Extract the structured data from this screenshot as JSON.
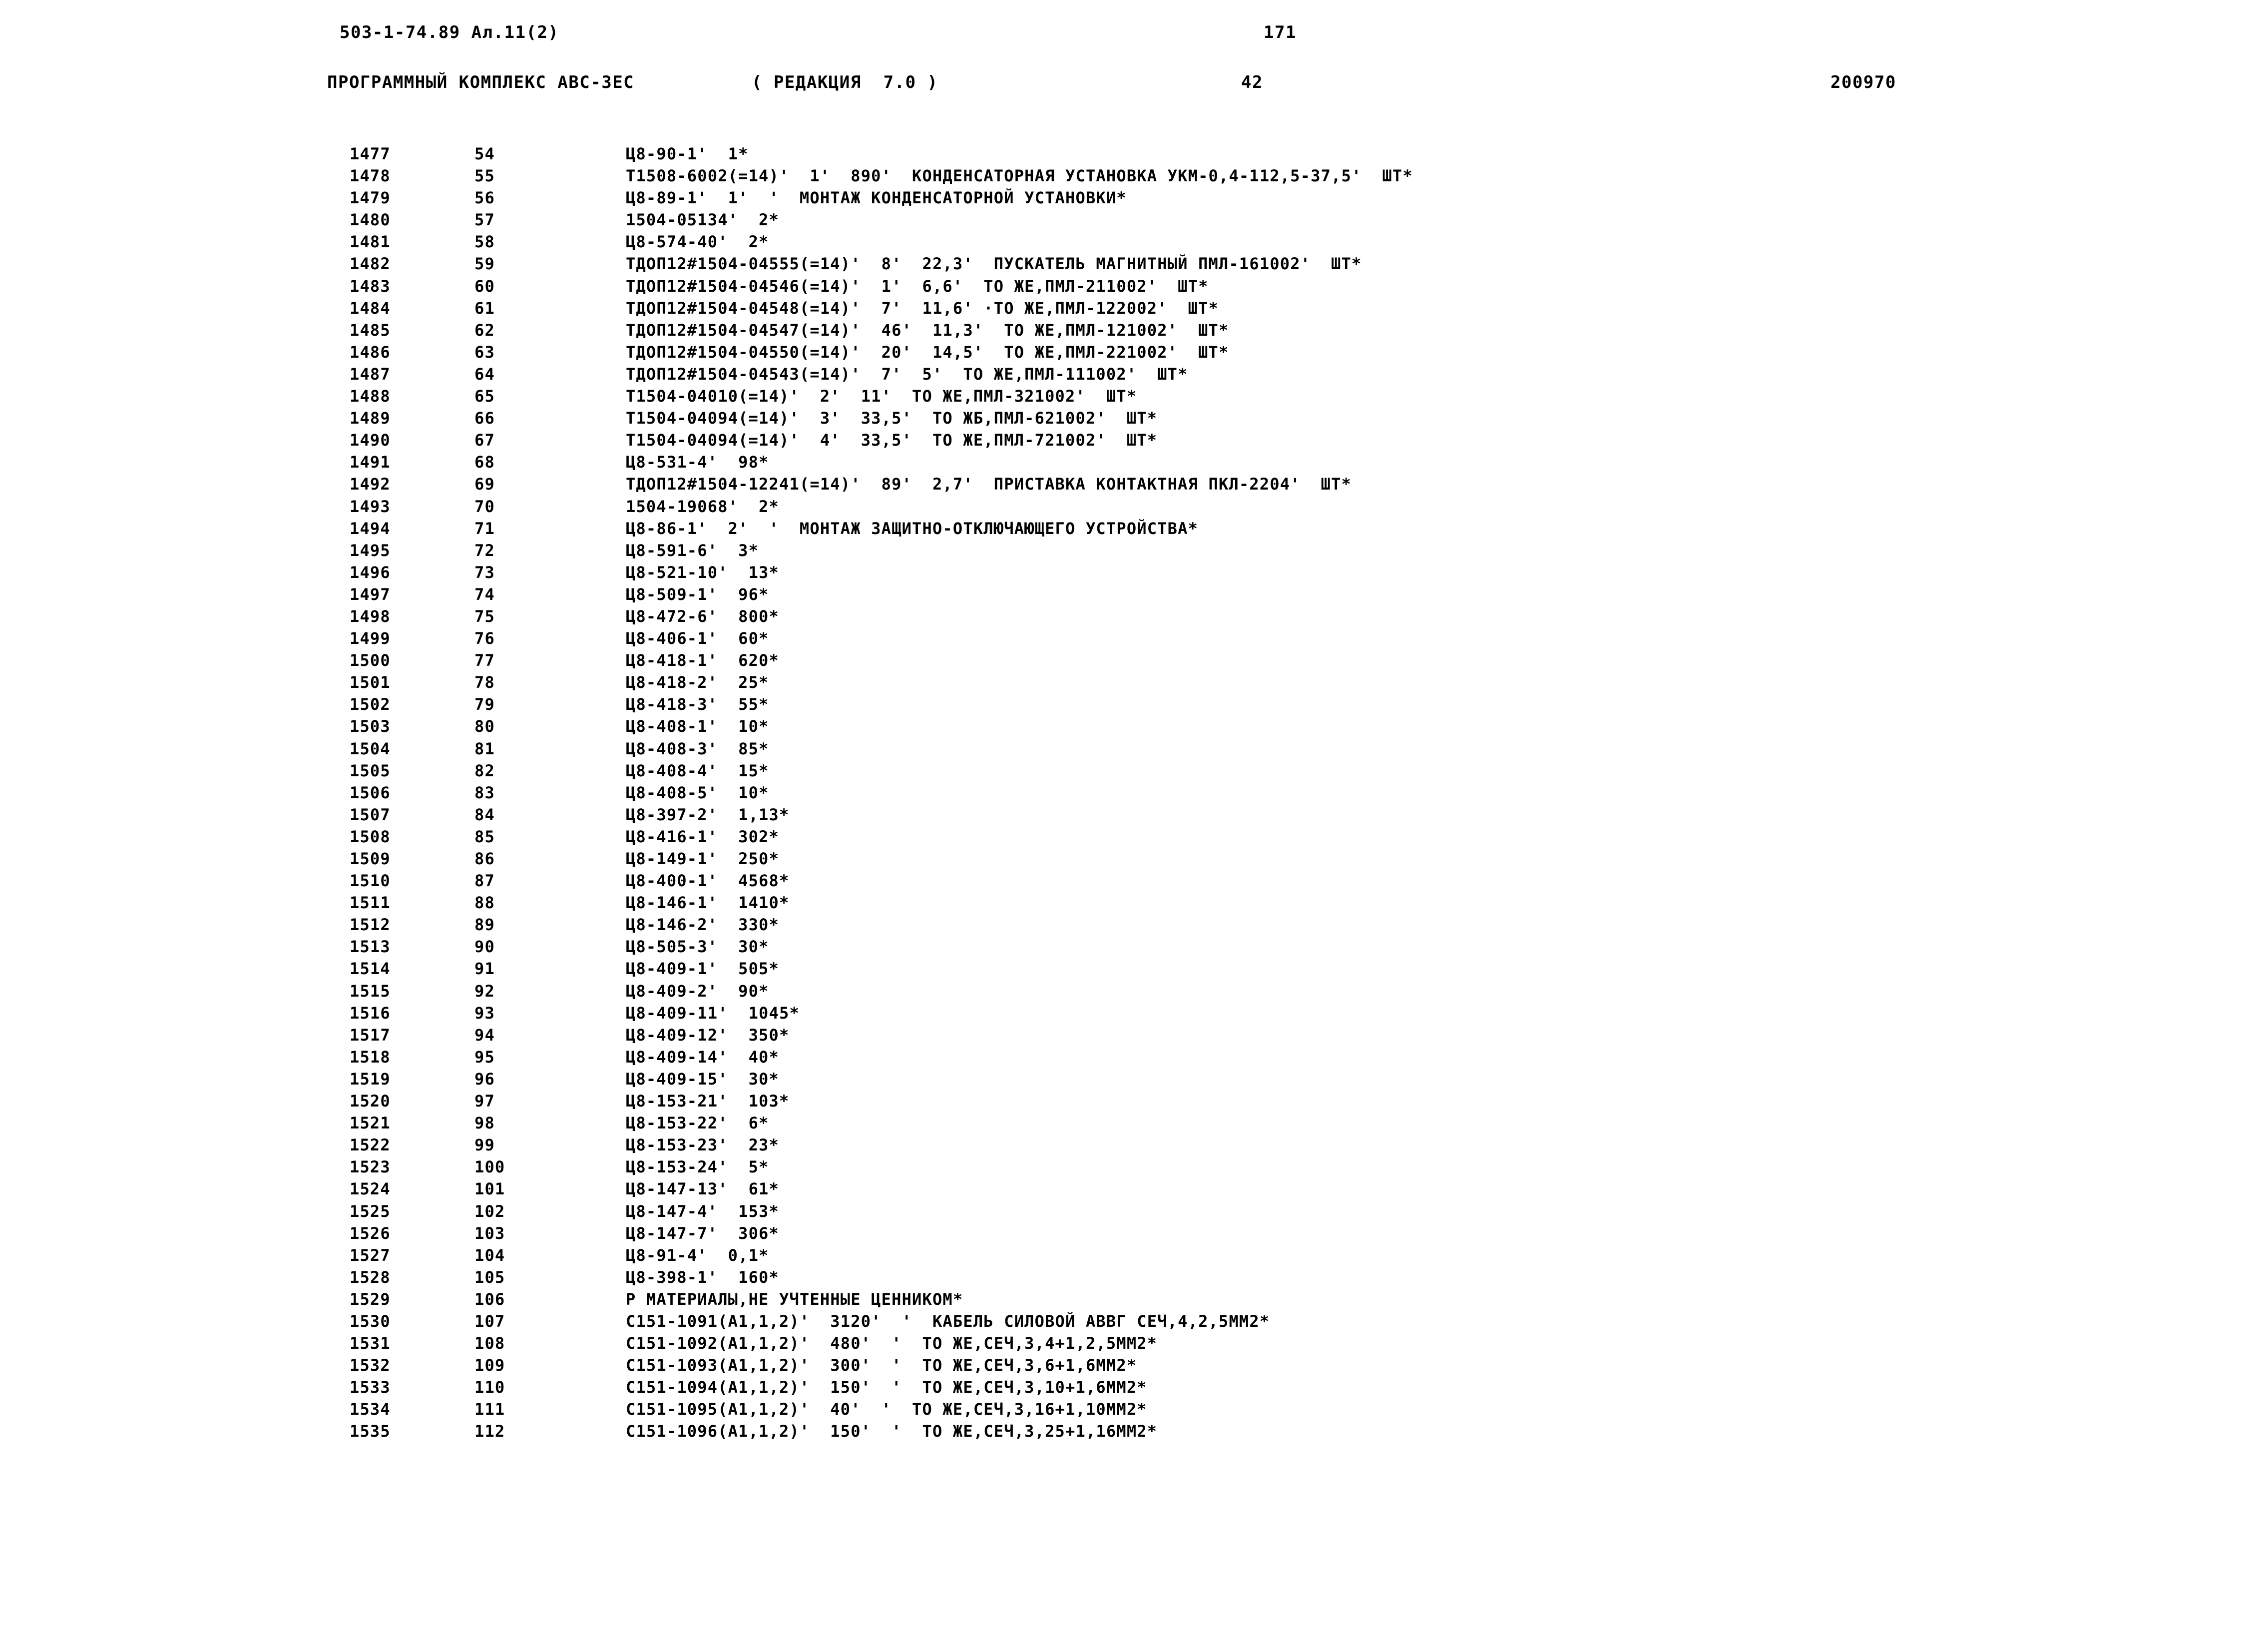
{
  "header": {
    "doc_code": "503-1-74.89 Ал.11(2)",
    "page_number": "171",
    "system_title": "ПРОГРАММНЫЙ КОМПЛЕКС АВС-3ЕС",
    "edition": "( РЕДАКЦИЯ  7.0 )",
    "sheet_number": "42",
    "date_code": "200970"
  },
  "listing": {
    "columns": [
      "line_number",
      "sequence_number",
      "record"
    ],
    "rows": [
      {
        "line_number": "1477",
        "sequence_number": "54",
        "record": "Ц8-90-1'  1*"
      },
      {
        "line_number": "1478",
        "sequence_number": "55",
        "record": "Т1508-6002(=14)'  1'  890'  КОНДЕНСАТОРНАЯ УСТАНОВКА УКМ-0,4-112,5-37,5'  ШТ*"
      },
      {
        "line_number": "1479",
        "sequence_number": "56",
        "record": "Ц8-89-1'  1'  '  МОНТАЖ КОНДЕНСАТОРНОЙ УСТАНОВКИ*"
      },
      {
        "line_number": "1480",
        "sequence_number": "57",
        "record": "1504-05134'  2*"
      },
      {
        "line_number": "1481",
        "sequence_number": "58",
        "record": "Ц8-574-40'  2*"
      },
      {
        "line_number": "1482",
        "sequence_number": "59",
        "record": "ТДОП12#1504-04555(=14)'  8'  22,3'  ПУСКАТЕЛЬ МАГНИТНЫЙ ПМЛ-161002'  ШТ*"
      },
      {
        "line_number": "1483",
        "sequence_number": "60",
        "record": "ТДОП12#1504-04546(=14)'  1'  6,6'  ТО ЖЕ,ПМЛ-211002'  ШТ*"
      },
      {
        "line_number": "1484",
        "sequence_number": "61",
        "record": "ТДОП12#1504-04548(=14)'  7'  11,6' ·ТО ЖЕ,ПМЛ-122002'  ШТ*"
      },
      {
        "line_number": "1485",
        "sequence_number": "62",
        "record": "ТДОП12#1504-04547(=14)'  46'  11,3'  ТО ЖЕ,ПМЛ-121002'  ШТ*"
      },
      {
        "line_number": "1486",
        "sequence_number": "63",
        "record": "ТДОП12#1504-04550(=14)'  20'  14,5'  ТО ЖЕ,ПМЛ-221002'  ШТ*"
      },
      {
        "line_number": "1487",
        "sequence_number": "64",
        "record": "ТДОП12#1504-04543(=14)'  7'  5'  ТО ЖЕ,ПМЛ-111002'  ШТ*"
      },
      {
        "line_number": "1488",
        "sequence_number": "65",
        "record": "Т1504-04010(=14)'  2'  11'  ТО ЖЕ,ПМЛ-321002'  ШТ*"
      },
      {
        "line_number": "1489",
        "sequence_number": "66",
        "record": "Т1504-04094(=14)'  3'  33,5'  ТО ЖБ,ПМЛ-621002'  ШТ*"
      },
      {
        "line_number": "1490",
        "sequence_number": "67",
        "record": "Т1504-04094(=14)'  4'  33,5'  ТО ЖЕ,ПМЛ-721002'  ШТ*"
      },
      {
        "line_number": "1491",
        "sequence_number": "68",
        "record": "Ц8-531-4'  98*"
      },
      {
        "line_number": "1492",
        "sequence_number": "69",
        "record": "ТДОП12#1504-12241(=14)'  89'  2,7'  ПРИСТАВКА КОНТАКТНАЯ ПКЛ-2204'  ШТ*"
      },
      {
        "line_number": "1493",
        "sequence_number": "70",
        "record": "1504-19068'  2*"
      },
      {
        "line_number": "1494",
        "sequence_number": "71",
        "record": "Ц8-86-1'  2'  '  МОНТАЖ ЗАЩИТНО-ОТКЛЮЧАЮЩЕГО УСТРОЙСТВА*"
      },
      {
        "line_number": "1495",
        "sequence_number": "72",
        "record": "Ц8-591-6'  3*"
      },
      {
        "line_number": "1496",
        "sequence_number": "73",
        "record": "Ц8-521-10'  13*"
      },
      {
        "line_number": "1497",
        "sequence_number": "74",
        "record": "Ц8-509-1'  96*"
      },
      {
        "line_number": "1498",
        "sequence_number": "75",
        "record": "Ц8-472-6'  800*"
      },
      {
        "line_number": "1499",
        "sequence_number": "76",
        "record": "Ц8-406-1'  60*"
      },
      {
        "line_number": "1500",
        "sequence_number": "77",
        "record": "Ц8-418-1'  620*"
      },
      {
        "line_number": "1501",
        "sequence_number": "78",
        "record": "Ц8-418-2'  25*"
      },
      {
        "line_number": "1502",
        "sequence_number": "79",
        "record": "Ц8-418-3'  55*"
      },
      {
        "line_number": "1503",
        "sequence_number": "80",
        "record": "Ц8-408-1'  10*"
      },
      {
        "line_number": "1504",
        "sequence_number": "81",
        "record": "Ц8-408-3'  85*"
      },
      {
        "line_number": "1505",
        "sequence_number": "82",
        "record": "Ц8-408-4'  15*"
      },
      {
        "line_number": "1506",
        "sequence_number": "83",
        "record": "Ц8-408-5'  10*"
      },
      {
        "line_number": "1507",
        "sequence_number": "84",
        "record": "Ц8-397-2'  1,13*"
      },
      {
        "line_number": "1508",
        "sequence_number": "85",
        "record": "Ц8-416-1'  302*"
      },
      {
        "line_number": "1509",
        "sequence_number": "86",
        "record": "Ц8-149-1'  250*"
      },
      {
        "line_number": "1510",
        "sequence_number": "87",
        "record": "Ц8-400-1'  4568*"
      },
      {
        "line_number": "1511",
        "sequence_number": "88",
        "record": "Ц8-146-1'  1410*"
      },
      {
        "line_number": "1512",
        "sequence_number": "89",
        "record": "Ц8-146-2'  330*"
      },
      {
        "line_number": "1513",
        "sequence_number": "90",
        "record": "Ц8-505-3'  30*"
      },
      {
        "line_number": "1514",
        "sequence_number": "91",
        "record": "Ц8-409-1'  505*"
      },
      {
        "line_number": "1515",
        "sequence_number": "92",
        "record": "Ц8-409-2'  90*"
      },
      {
        "line_number": "1516",
        "sequence_number": "93",
        "record": "Ц8-409-11'  1045*"
      },
      {
        "line_number": "1517",
        "sequence_number": "94",
        "record": "Ц8-409-12'  350*"
      },
      {
        "line_number": "1518",
        "sequence_number": "95",
        "record": "Ц8-409-14'  40*"
      },
      {
        "line_number": "1519",
        "sequence_number": "96",
        "record": "Ц8-409-15'  30*"
      },
      {
        "line_number": "1520",
        "sequence_number": "97",
        "record": "Ц8-153-21'  103*"
      },
      {
        "line_number": "1521",
        "sequence_number": "98",
        "record": "Ц8-153-22'  6*"
      },
      {
        "line_number": "1522",
        "sequence_number": "99",
        "record": "Ц8-153-23'  23*"
      },
      {
        "line_number": "1523",
        "sequence_number": "100",
        "record": "Ц8-153-24'  5*"
      },
      {
        "line_number": "1524",
        "sequence_number": "101",
        "record": "Ц8-147-13'  61*"
      },
      {
        "line_number": "1525",
        "sequence_number": "102",
        "record": "Ц8-147-4'  153*"
      },
      {
        "line_number": "1526",
        "sequence_number": "103",
        "record": "Ц8-147-7'  306*"
      },
      {
        "line_number": "1527",
        "sequence_number": "104",
        "record": "Ц8-91-4'  0,1*"
      },
      {
        "line_number": "1528",
        "sequence_number": "105",
        "record": "Ц8-398-1'  160*"
      },
      {
        "line_number": "1529",
        "sequence_number": "106",
        "record": "Р МАТЕРИАЛЫ,НЕ УЧТЕННЫЕ ЦЕННИКОМ*"
      },
      {
        "line_number": "1530",
        "sequence_number": "107",
        "record": "С151-1091(А1,1,2)'  3120'  '  КАБЕЛЬ СИЛОВОЙ АВВГ СЕЧ,4,2,5ММ2*"
      },
      {
        "line_number": "1531",
        "sequence_number": "108",
        "record": "С151-1092(А1,1,2)'  480'  '  ТО ЖЕ,СЕЧ,3,4+1,2,5ММ2*"
      },
      {
        "line_number": "1532",
        "sequence_number": "109",
        "record": "С151-1093(А1,1,2)'  300'  '  ТО ЖЕ,СЕЧ,3,6+1,6ММ2*"
      },
      {
        "line_number": "1533",
        "sequence_number": "110",
        "record": "С151-1094(А1,1,2)'  150'  '  ТО ЖЕ,СЕЧ,3,10+1,6ММ2*"
      },
      {
        "line_number": "1534",
        "sequence_number": "111",
        "record": "С151-1095(А1,1,2)'  40'  '  ТО ЖЕ,СЕЧ,3,16+1,10ММ2*"
      },
      {
        "line_number": "1535",
        "sequence_number": "112",
        "record": "С151-1096(А1,1,2)'  150'  '  ТО ЖЕ,СЕЧ,3,25+1,16ММ2*"
      }
    ]
  }
}
